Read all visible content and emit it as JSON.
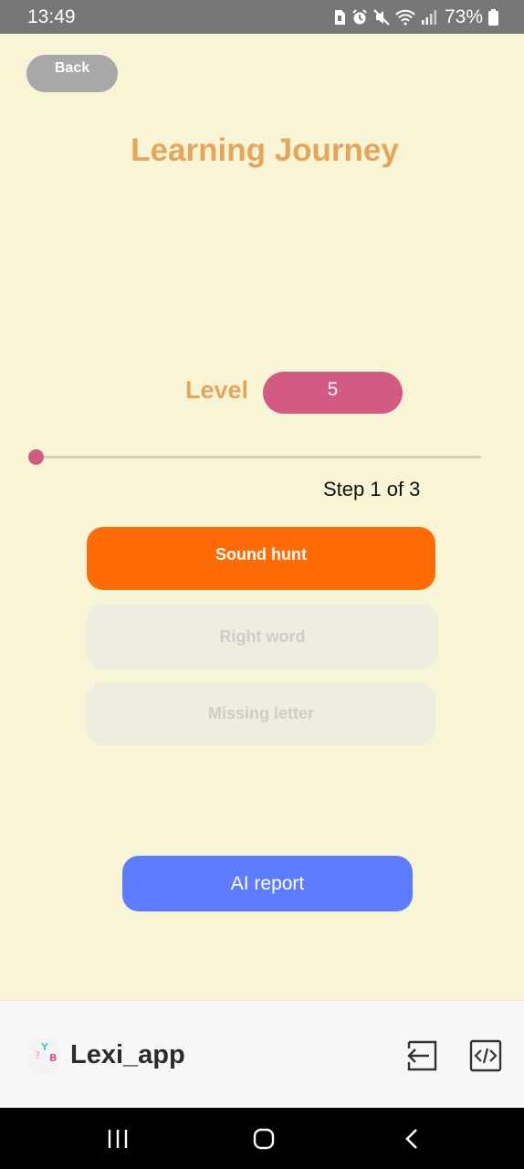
{
  "status_bar": {
    "time": "13:49",
    "battery": "73%",
    "icons": [
      "sim-icon",
      "alarm-icon",
      "mute-icon",
      "wifi-icon",
      "signal-icon",
      "battery-icon"
    ]
  },
  "header": {
    "back_label": "Back",
    "title": "Learning Journey"
  },
  "level": {
    "label": "Level",
    "value": "5"
  },
  "progress": {
    "fraction": 0.0,
    "step_text": "Step 1  of 3"
  },
  "stages": [
    {
      "label": "Sound hunt",
      "state": "active"
    },
    {
      "label": "Right word",
      "state": "disabled"
    },
    {
      "label": "Missing letter",
      "state": "disabled"
    }
  ],
  "ai_report_label": "AI report",
  "bottom_bar": {
    "app_name": "Lexi_app",
    "icons": [
      "exit-icon",
      "code-icon"
    ]
  },
  "nav_bar": {
    "icons": [
      "recent-apps-icon",
      "home-icon",
      "back-nav-icon"
    ]
  },
  "colors": {
    "background": "#f8f4d6",
    "title": "#e6a65a",
    "level_pill": "#d35a82",
    "active_stage": "#ff6b05",
    "ai_report": "#5e7cff"
  }
}
